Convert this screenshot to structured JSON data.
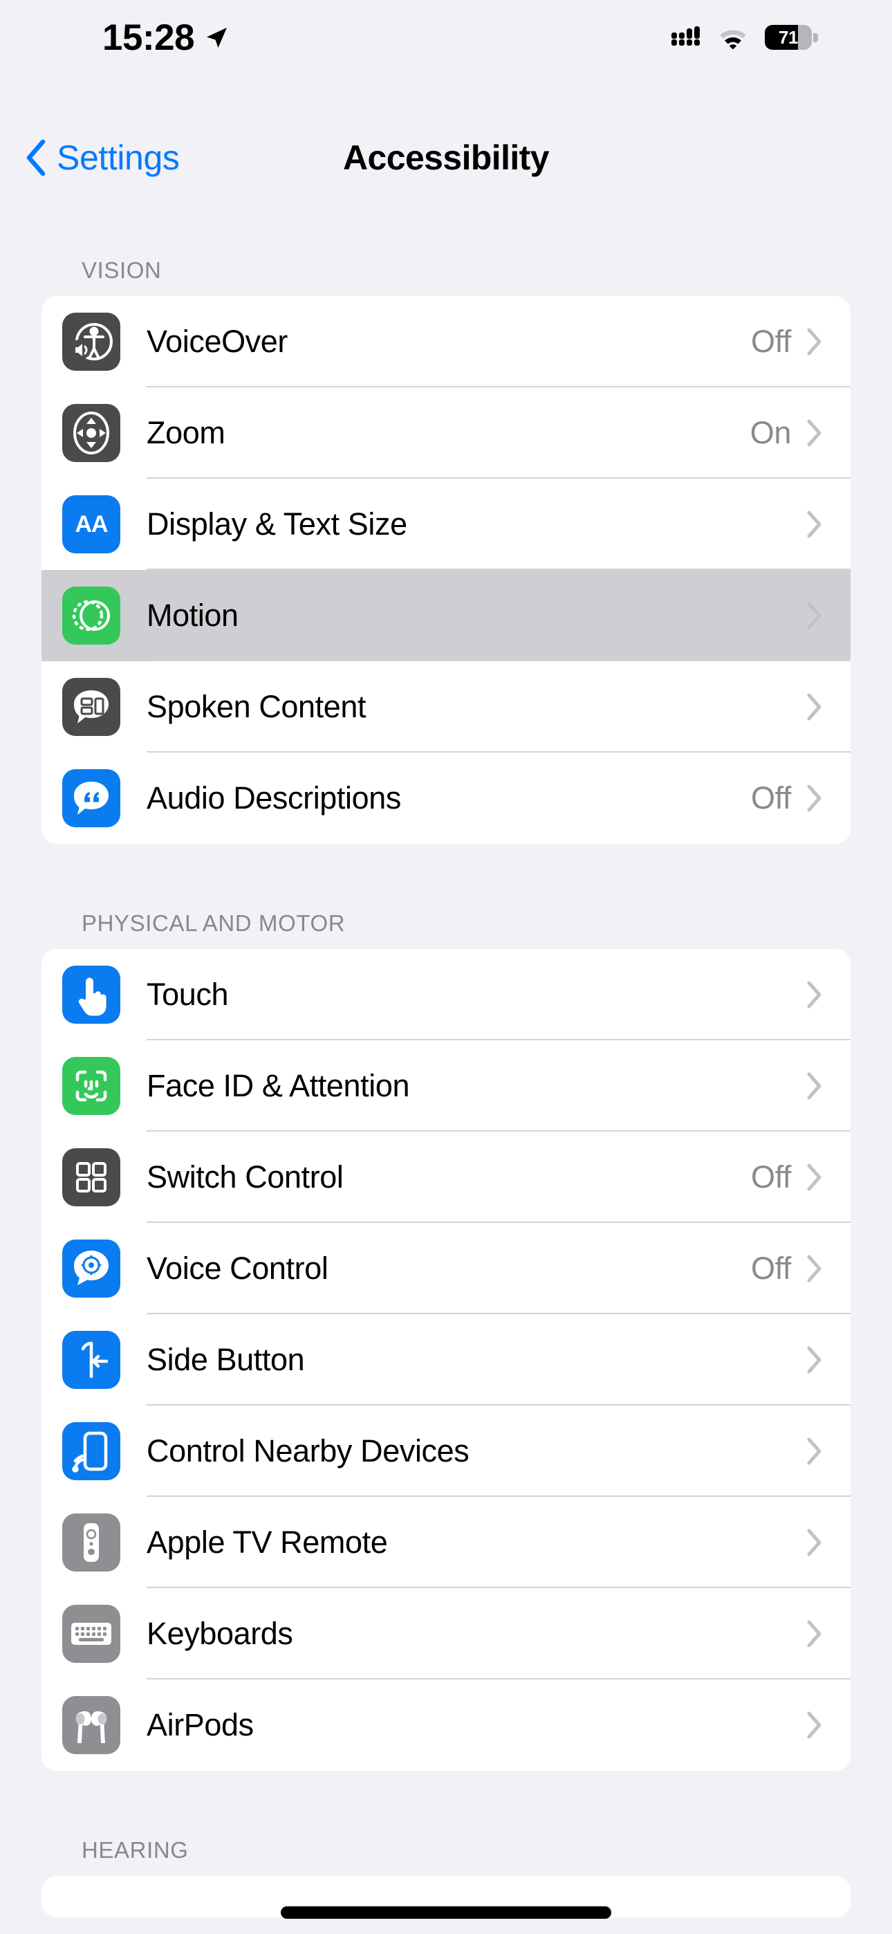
{
  "status_bar": {
    "time": "15:28",
    "location_icon": "location-arrow-icon",
    "cellular_icon": "cellular-signal-icon",
    "cellular_bars": 4,
    "wifi_icon": "wifi-icon",
    "battery_percent": "71",
    "battery_level": 71
  },
  "nav": {
    "back_label": "Settings",
    "back_icon": "chevron-left-icon",
    "title": "Accessibility"
  },
  "colors": {
    "page_background": "#f2f1f6",
    "card_background": "#ffffff",
    "accent_blue": "#007aff",
    "icon_blue": "#0a7cf0",
    "icon_green": "#34c85a",
    "icon_dark_gray": "#4a4a4c",
    "icon_mid_gray": "#8e8e93",
    "selected_row": "#cfced3",
    "secondary_text": "#8a8a8e",
    "section_header_text": "#888890",
    "separator": "#d4d3d8"
  },
  "sections": [
    {
      "header": "VISION",
      "rows": [
        {
          "label": "VoiceOver",
          "value": "Off",
          "icon": "voiceover-icon",
          "icon_style": "gray",
          "selected": false
        },
        {
          "label": "Zoom",
          "value": "On",
          "icon": "zoom-icon",
          "icon_style": "gray",
          "selected": false
        },
        {
          "label": "Display & Text Size",
          "value": "",
          "icon": "display-text-size-icon",
          "icon_style": "blue",
          "selected": false
        },
        {
          "label": "Motion",
          "value": "",
          "icon": "motion-icon",
          "icon_style": "green",
          "selected": true
        },
        {
          "label": "Spoken Content",
          "value": "",
          "icon": "spoken-content-icon",
          "icon_style": "gray",
          "selected": false
        },
        {
          "label": "Audio Descriptions",
          "value": "Off",
          "icon": "audio-descriptions-icon",
          "icon_style": "blue",
          "selected": false
        }
      ]
    },
    {
      "header": "PHYSICAL AND MOTOR",
      "rows": [
        {
          "label": "Touch",
          "value": "",
          "icon": "touch-icon",
          "icon_style": "blue",
          "selected": false
        },
        {
          "label": "Face ID & Attention",
          "value": "",
          "icon": "face-id-icon",
          "icon_style": "green",
          "selected": false
        },
        {
          "label": "Switch Control",
          "value": "Off",
          "icon": "switch-control-icon",
          "icon_style": "gray",
          "selected": false
        },
        {
          "label": "Voice Control",
          "value": "Off",
          "icon": "voice-control-icon",
          "icon_style": "blue",
          "selected": false
        },
        {
          "label": "Side Button",
          "value": "",
          "icon": "side-button-icon",
          "icon_style": "blue",
          "selected": false
        },
        {
          "label": "Control Nearby Devices",
          "value": "",
          "icon": "control-nearby-devices-icon",
          "icon_style": "blue",
          "selected": false
        },
        {
          "label": "Apple TV Remote",
          "value": "",
          "icon": "apple-tv-remote-icon",
          "icon_style": "midgray",
          "selected": false
        },
        {
          "label": "Keyboards",
          "value": "",
          "icon": "keyboards-icon",
          "icon_style": "midgray",
          "selected": false
        },
        {
          "label": "AirPods",
          "value": "",
          "icon": "airpods-icon",
          "icon_style": "midgray",
          "selected": false
        }
      ]
    },
    {
      "header": "HEARING",
      "rows": []
    }
  ]
}
